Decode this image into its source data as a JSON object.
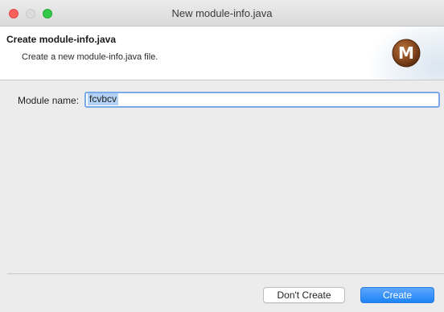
{
  "window": {
    "title": "New module-info.java"
  },
  "banner": {
    "title": "Create module-info.java",
    "description": "Create a new module-info.java file.",
    "logo_icon": "maven-m-icon",
    "logo_letter": "M"
  },
  "form": {
    "module_name_label": "Module name:",
    "module_name_value": "fcvbcv"
  },
  "footer": {
    "dont_create_label": "Don't Create",
    "create_label": "Create"
  },
  "colors": {
    "accent": "#1d84f5",
    "logo_brown": "#8a4a1f",
    "close": "#fc605c",
    "maximize": "#34c84a"
  }
}
